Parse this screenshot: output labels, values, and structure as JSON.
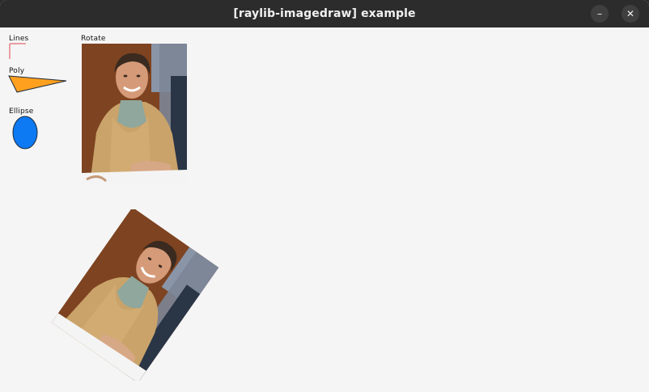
{
  "window": {
    "title": "[raylib-imagedraw] example",
    "minimize_glyph": "–",
    "close_glyph": "✕"
  },
  "canvas": {
    "labels": {
      "lines": "Lines",
      "poly": "Poly",
      "ellipse": "Ellipse",
      "rotate": "Rotate"
    }
  },
  "colors": {
    "canvas_bg": "#f5f5f5",
    "titlebar": "#2c2c2c",
    "line": "#e0484d",
    "poly_fill": "#ffa01e",
    "ellipse_fill": "#0d79f2",
    "outline": "#1e2a3a"
  },
  "icons": {
    "minimize": "minimize-icon",
    "close": "close-icon"
  }
}
